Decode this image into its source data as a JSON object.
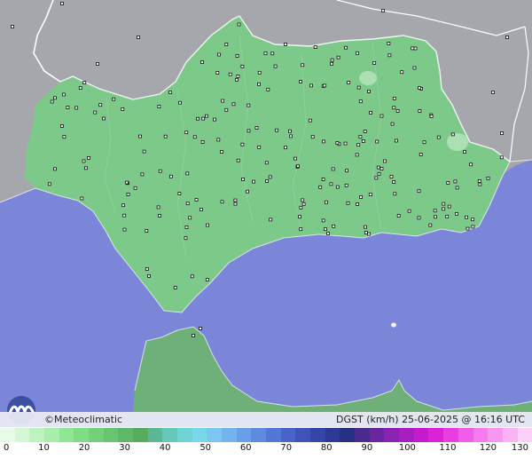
{
  "footer": {
    "credit": "©Meteoclimatic",
    "product": "DGST (km/h)",
    "timestamp": "25-06-2025 @ 16:16 UTC"
  },
  "logo": {
    "icon": "meteoclimatic-logo-icon",
    "colors": {
      "circle": "#3b4fa3",
      "wave": "#ffffff"
    }
  },
  "colors": {
    "sea": "#7b86d8",
    "land_outside": "#a6a6ad",
    "region_fill": "#7dc98a",
    "morocco_fill": "#6fb078",
    "border_line": "#ffffff",
    "station_marker": "#111111"
  },
  "legend": {
    "unit": "km/h",
    "ticks": [
      "0",
      "10",
      "20",
      "30",
      "40",
      "50",
      "60",
      "70",
      "80",
      "90",
      "100",
      "110",
      "120",
      "130"
    ],
    "colors": [
      "#e8fbe8",
      "#d4f7d4",
      "#bdf3bf",
      "#a6eea9",
      "#8fe793",
      "#7fde84",
      "#73d17a",
      "#69c470",
      "#5fb867",
      "#56ac5e",
      "#5cb894",
      "#65c8b8",
      "#6fd3d6",
      "#7ad7ea",
      "#7cc7f2",
      "#73b4ee",
      "#699fe8",
      "#5e8be0",
      "#5277d6",
      "#4864c9",
      "#3f53ba",
      "#3645a8",
      "#2e3a95",
      "#283083",
      "#4a2b8f",
      "#6a26a0",
      "#8b22b2",
      "#a91ec1",
      "#c51acd",
      "#dc22d6",
      "#e83ee0",
      "#f05ee8",
      "#f57bee",
      "#f897f2",
      "#fbb3f6",
      "#fdd0fa"
    ]
  },
  "stations": {
    "count": 210,
    "marker_icon": "station-marker-icon"
  }
}
